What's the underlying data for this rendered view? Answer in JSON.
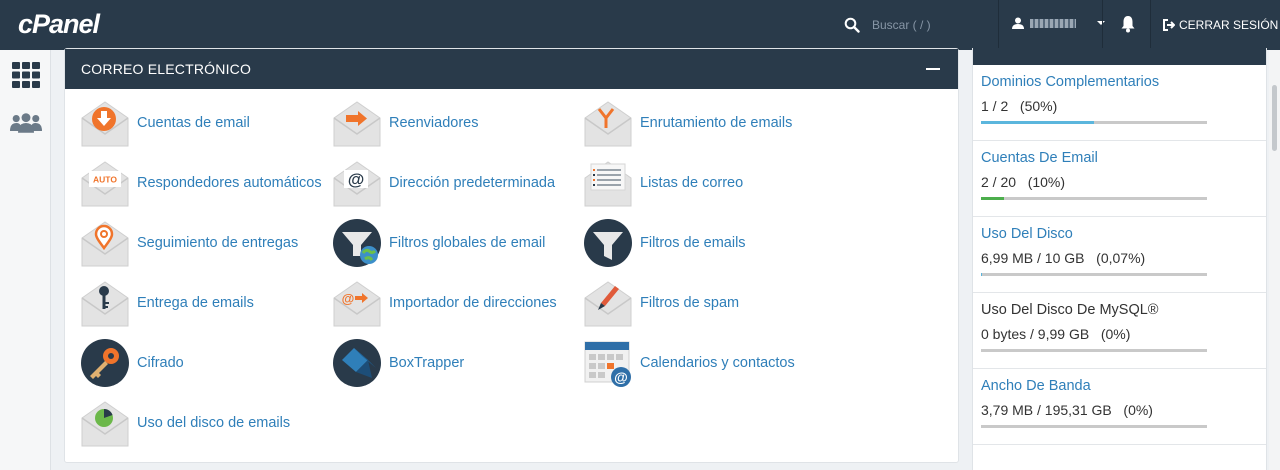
{
  "app": {
    "logo": "cPanel"
  },
  "topbar": {
    "search_placeholder": "Buscar ( / )",
    "logout_label": "CERRAR SESIÓN"
  },
  "panel": {
    "title": "CORREO ELECTRÓNICO",
    "items": [
      {
        "label": "Cuentas de email",
        "icon": "email-accounts-icon"
      },
      {
        "label": "Reenviadores",
        "icon": "forwarders-icon"
      },
      {
        "label": "Enrutamiento de emails",
        "icon": "email-routing-icon"
      },
      {
        "label": "Respondedores automáticos",
        "icon": "autoresponders-icon",
        "badge": "AUTO"
      },
      {
        "label": "Dirección predeterminada",
        "icon": "default-address-icon"
      },
      {
        "label": "Listas de correo",
        "icon": "mailing-lists-icon"
      },
      {
        "label": "Seguimiento de entregas",
        "icon": "track-delivery-icon"
      },
      {
        "label": "Filtros globales de email",
        "icon": "global-filters-icon"
      },
      {
        "label": "Filtros de emails",
        "icon": "email-filters-icon"
      },
      {
        "label": "Entrega de emails",
        "icon": "email-deliverability-icon"
      },
      {
        "label": "Importador de direcciones",
        "icon": "address-importer-icon"
      },
      {
        "label": "Filtros de spam",
        "icon": "spam-filters-icon"
      },
      {
        "label": "Cifrado",
        "icon": "encryption-icon"
      },
      {
        "label": "BoxTrapper",
        "icon": "boxtrapper-icon"
      },
      {
        "label": "Calendarios y contactos",
        "icon": "calendars-contacts-icon"
      },
      {
        "label": "Uso del disco de emails",
        "icon": "email-disk-usage-icon"
      }
    ]
  },
  "stats": [
    {
      "title": "Dominios Complementarios",
      "value": "1 / 2   (50%)",
      "percent": 50,
      "color": "#5bb6dd",
      "link": true
    },
    {
      "title": "Cuentas De Email",
      "value": "2 / 20   (10%)",
      "percent": 10,
      "color": "#4cae4c",
      "link": true
    },
    {
      "title": "Uso Del Disco",
      "value": "6,99 MB / 10 GB   (0,07%)",
      "percent": 0.07,
      "color": "#5bb6dd",
      "link": true
    },
    {
      "title": "Uso Del Disco De MySQL®",
      "value": "0 bytes / 9,99 GB   (0%)",
      "percent": 0,
      "color": "#5bb6dd",
      "link": false
    },
    {
      "title": "Ancho De Banda",
      "value": "3,79 MB / 195,31 GB   (0%)",
      "percent": 0,
      "color": "#5bb6dd",
      "link": true
    }
  ],
  "colors": {
    "header": "#293a4a",
    "link": "#2f7fb9"
  }
}
